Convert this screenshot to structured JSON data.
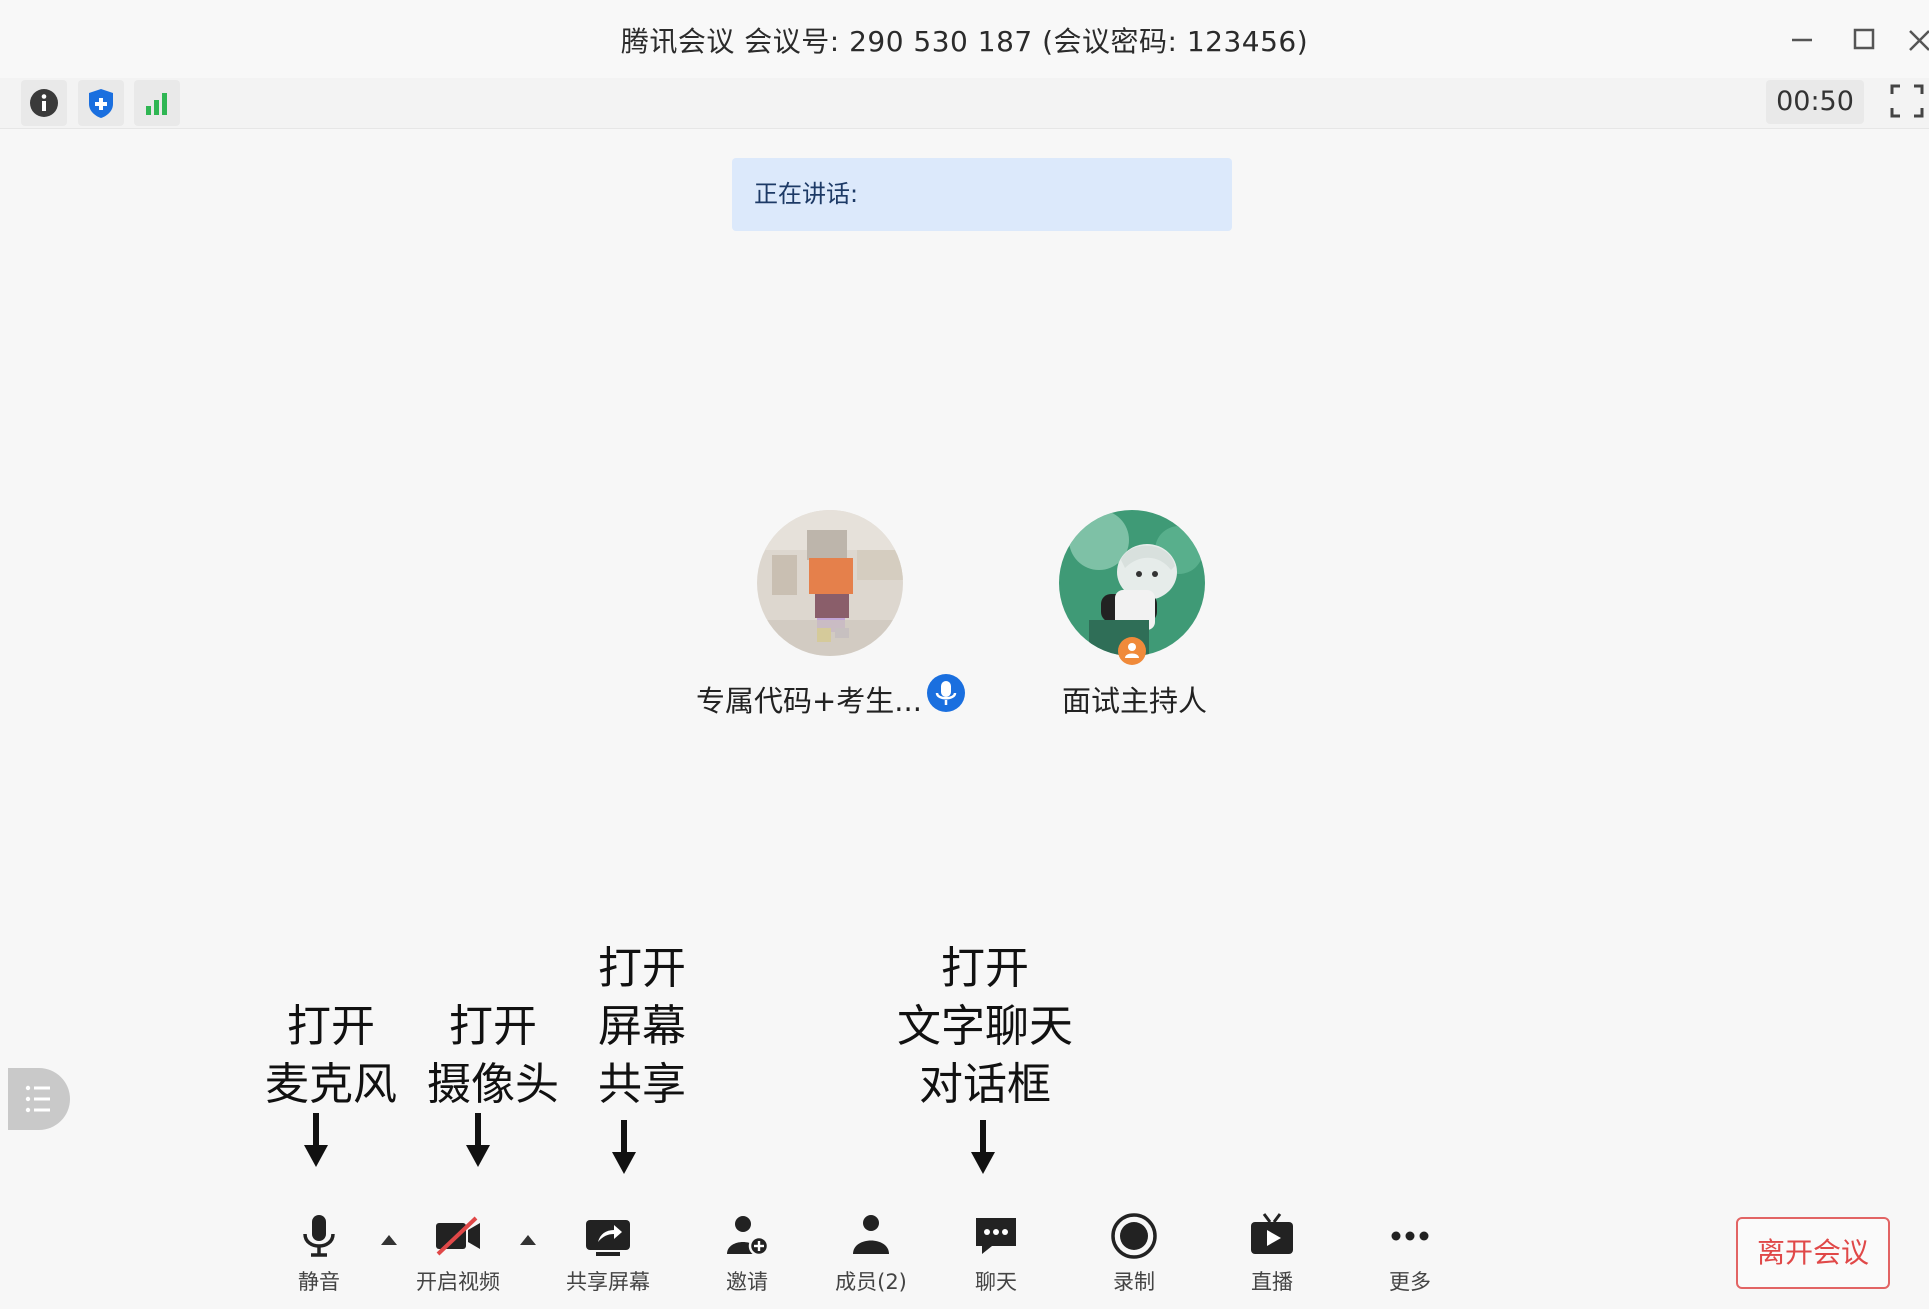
{
  "window": {
    "title": "腾讯会议 会议号: 290 530 187 (会议密码: 123456)"
  },
  "toolbar": {
    "icons": [
      "info-icon",
      "shield-icon",
      "signal-icon"
    ],
    "timer": "00:50"
  },
  "speaking": {
    "label": "正在讲话:"
  },
  "participants": [
    {
      "name": "专属代码+考生...",
      "mic": "on"
    },
    {
      "name": "面试主持人",
      "role": "host"
    }
  ],
  "annotations": [
    {
      "lines": [
        "打开",
        "麦克风"
      ]
    },
    {
      "lines": [
        "打开",
        "摄像头"
      ]
    },
    {
      "lines": [
        "打开",
        "屏幕",
        "共享"
      ]
    },
    {
      "lines": [
        "打开",
        "文字聊天",
        "对话框"
      ]
    }
  ],
  "controls": [
    {
      "label": "静音",
      "icon": "microphone-icon"
    },
    {
      "label": "开启视频",
      "icon": "camera-off-icon"
    },
    {
      "label": "共享屏幕",
      "icon": "share-screen-icon"
    },
    {
      "label": "邀请",
      "icon": "invite-icon"
    },
    {
      "label": "成员(2)",
      "icon": "members-icon"
    },
    {
      "label": "聊天",
      "icon": "chat-icon"
    },
    {
      "label": "录制",
      "icon": "record-icon"
    },
    {
      "label": "直播",
      "icon": "live-icon"
    },
    {
      "label": "更多",
      "icon": "more-icon"
    }
  ],
  "leave": {
    "label": "离开会议"
  },
  "colors": {
    "accent_blue": "#1a6fdf",
    "leave_red": "#e04848",
    "speaking_bg": "#dce9fb",
    "signal_green": "#2fb653"
  }
}
